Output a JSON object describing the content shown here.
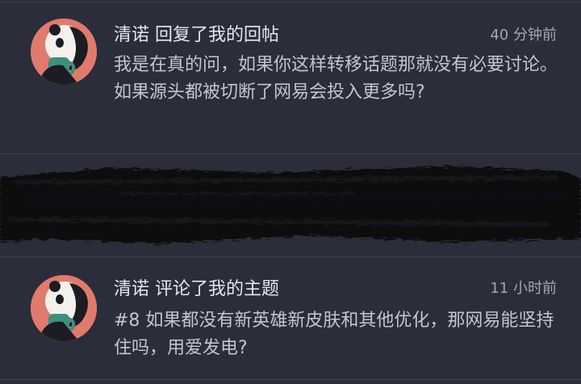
{
  "notifications": [
    {
      "user": "清诺",
      "action": "回复了我的回帖",
      "time": "40 分钟前",
      "text": "我是在真的问，如果你这样转移话题那就没有必要讨论。如果源头都被切断了网易会投入更多吗?"
    },
    {
      "redacted": true
    },
    {
      "user": "清诺",
      "action": "评论了我的主题",
      "time": "11 小时前",
      "text": "#8 如果都没有新英雄新皮肤和其他优化，那网易能坚持住吗，用爱发电?"
    }
  ],
  "colors": {
    "background": "#2b2d3a",
    "divider": "#3e4150",
    "title": "#e6e6ea",
    "body": "#c3c5cf",
    "time": "#a4a6b2",
    "avatar_bg": "#e07a6c"
  }
}
